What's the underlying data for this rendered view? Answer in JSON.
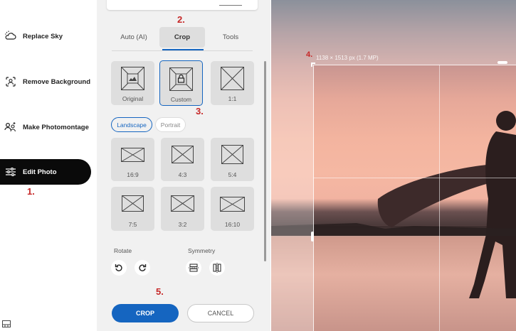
{
  "sidebar": {
    "items": [
      {
        "label": "Replace Sky",
        "icon": "cloud-sun-icon"
      },
      {
        "label": "Remove Background",
        "icon": "person-frame-icon"
      },
      {
        "label": "Make Photomontage",
        "icon": "montage-icon"
      },
      {
        "label": "Edit Photo",
        "icon": "sliders-icon",
        "active": true
      }
    ]
  },
  "tabs": [
    {
      "label": "Auto (AI)"
    },
    {
      "label": "Crop",
      "active": true
    },
    {
      "label": "Tools"
    }
  ],
  "presets_top": [
    {
      "label": "Original"
    },
    {
      "label": "Custom",
      "selected": true
    },
    {
      "label": "1:1"
    }
  ],
  "orientation": {
    "landscape": "Landscape",
    "portrait": "Portrait",
    "selected": "Landscape"
  },
  "ratios": [
    {
      "label": "16:9"
    },
    {
      "label": "4:3"
    },
    {
      "label": "5:4"
    },
    {
      "label": "7:5"
    },
    {
      "label": "3:2"
    },
    {
      "label": "16:10"
    }
  ],
  "rotate": {
    "label": "Rotate"
  },
  "symmetry": {
    "label": "Symmetry"
  },
  "actions": {
    "crop": "CROP",
    "cancel": "CANCEL"
  },
  "crop_info": "1138 × 1513 px (1.7 MP)",
  "steps": {
    "s1": "1.",
    "s2": "2.",
    "s3": "3.",
    "s4": "4.",
    "s5": "5."
  },
  "colors": {
    "accent": "#1565c0",
    "step_red": "#c62828",
    "active_nav": "#0a0a0a"
  }
}
